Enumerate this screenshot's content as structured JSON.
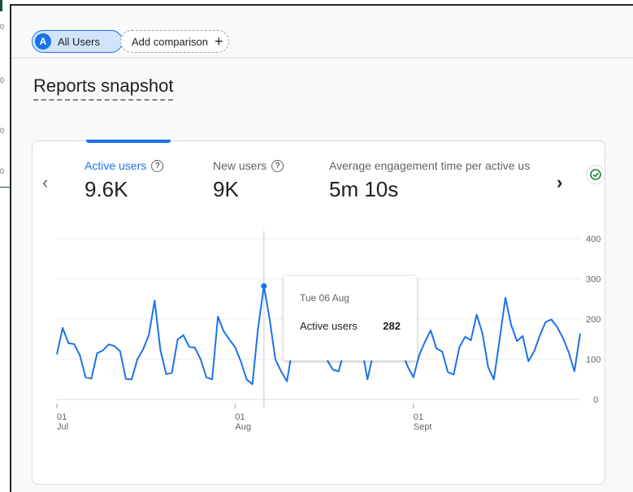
{
  "left_axis": {
    "ticks": [
      "0",
      "0",
      "0",
      "0"
    ]
  },
  "comparison": {
    "avatar_letter": "A",
    "all_users_label": "All Users",
    "add_label": "Add comparison",
    "add_icon": "plus-icon"
  },
  "page": {
    "title": "Reports snapshot"
  },
  "card": {
    "prev_icon": "‹",
    "next_icon": "›",
    "metrics": [
      {
        "label": "Active users",
        "value": "9.6K"
      },
      {
        "label": "New users",
        "value": "9K"
      },
      {
        "label": "Average engagement time per active us",
        "value": "5m 10s"
      }
    ],
    "help_glyph": "?",
    "status_icon": "check-circle-icon"
  },
  "tooltip": {
    "date": "Tue 06 Aug",
    "metric_label": "Active users",
    "metric_value": "282"
  },
  "chart_data": {
    "type": "line",
    "x_start": "2024-07-01",
    "x_ticks": [
      {
        "day": "01",
        "month": "Jul"
      },
      {
        "day": "01",
        "month": "Aug"
      },
      {
        "day": "01",
        "month": "Sept"
      }
    ],
    "y_ticks": [
      0,
      100,
      200,
      300,
      400
    ],
    "ylim": [
      0,
      400
    ],
    "grid": true,
    "series": [
      {
        "color": "#1a73e8",
        "values": [
          112,
          178,
          140,
          138,
          110,
          55,
          52,
          115,
          122,
          137,
          133,
          120,
          51,
          50,
          100,
          125,
          160,
          246,
          123,
          63,
          66,
          149,
          160,
          131,
          129,
          100,
          55,
          50,
          206,
          170,
          149,
          130,
          94,
          50,
          38,
          180,
          282,
          200,
          100,
          70,
          45,
          130,
          140,
          132,
          134,
          133,
          132,
          98,
          74,
          70,
          125,
          131,
          132,
          130,
          50,
          114,
          130,
          180,
          120,
          120,
          120,
          82,
          55,
          110,
          143,
          172,
          127,
          119,
          68,
          62,
          130,
          156,
          147,
          211,
          165,
          80,
          50,
          150,
          253,
          185,
          145,
          158,
          95,
          120,
          160,
          193,
          199,
          180,
          153,
          118,
          70,
          164
        ]
      }
    ],
    "highlight_index": 36
  }
}
